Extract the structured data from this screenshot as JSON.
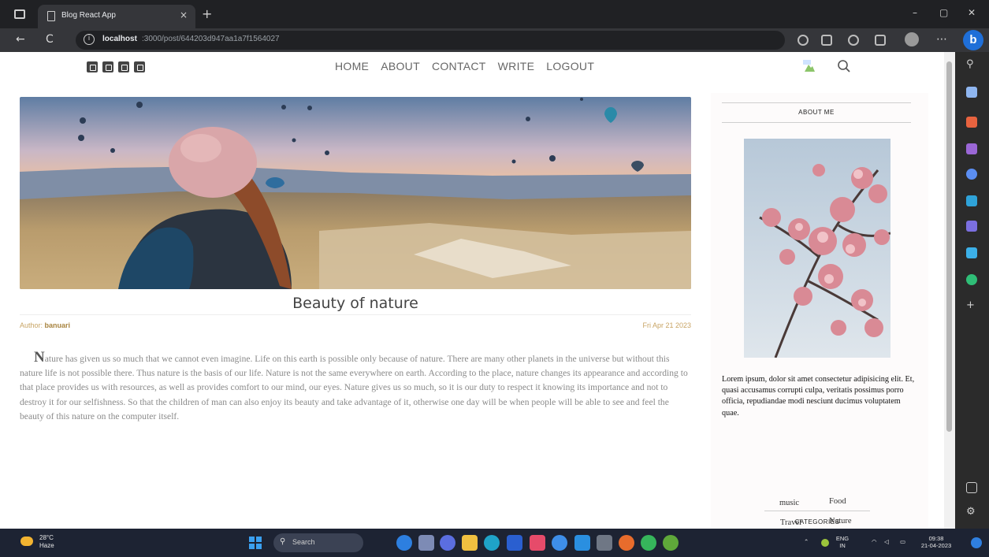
{
  "browser": {
    "tab_title": "Blog React App",
    "tab_close": "×",
    "new_tab": "+",
    "url_host": "localhost",
    "url_path": ":3000/post/644203d947aa1a7f1564027",
    "nav_back": "←",
    "nav_reload": "C",
    "bing_label": "b",
    "window_minimize": "–",
    "window_restore": "▢",
    "window_close": "✕"
  },
  "site": {
    "nav_items": [
      "HOME",
      "ABOUT",
      "CONTACT",
      "WRITE",
      "LOGOUT"
    ],
    "social_icons": [
      "facebook-square-icon",
      "twitter-square-icon",
      "pinterest-square-icon",
      "instagram-square-icon"
    ]
  },
  "post": {
    "title": "Beauty of nature",
    "author_label": "Author: ",
    "author_name": "banuari",
    "date": "Fri Apr 21 2023",
    "body_first_letter": "N",
    "body_rest": "ature has given us so much that we cannot even imagine. Life on this earth is possible only because of nature. There are many other planets in the universe but without this nature life is not possible there. Thus nature is the basis of our life. Nature is not the same everywhere on earth. According to the place, nature changes its appearance and according to that place provides us with resources, as well as provides comfort to our mind, our eyes. Nature gives us so much, so it is our duty to respect it knowing its importance and not to destroy it for our selfishness. So that the children of man can also enjoy its beauty and take advantage of it, otherwise one day will be when people will be able to see and feel the beauty of this nature on the computer itself."
  },
  "sidebar": {
    "about_title": "ABOUT ME",
    "about_text": "Lorem ipsum, dolor sit amet consectetur adipisicing elit. Et, quasi accusamus corrupti culpa, veritatis possimus porro officia, repudiandae modi nesciunt ducimus voluptatem quae.",
    "categories_title": "CATEGORIES",
    "categories": [
      "music",
      "Food",
      "Travel",
      "Nature"
    ]
  },
  "taskbar": {
    "weather_temp": "28°C",
    "weather_desc": "Haze",
    "search_placeholder": "Search",
    "lang_top": "ENG",
    "lang_bottom": "IN",
    "time": "09:38",
    "date": "21-04-2023"
  }
}
